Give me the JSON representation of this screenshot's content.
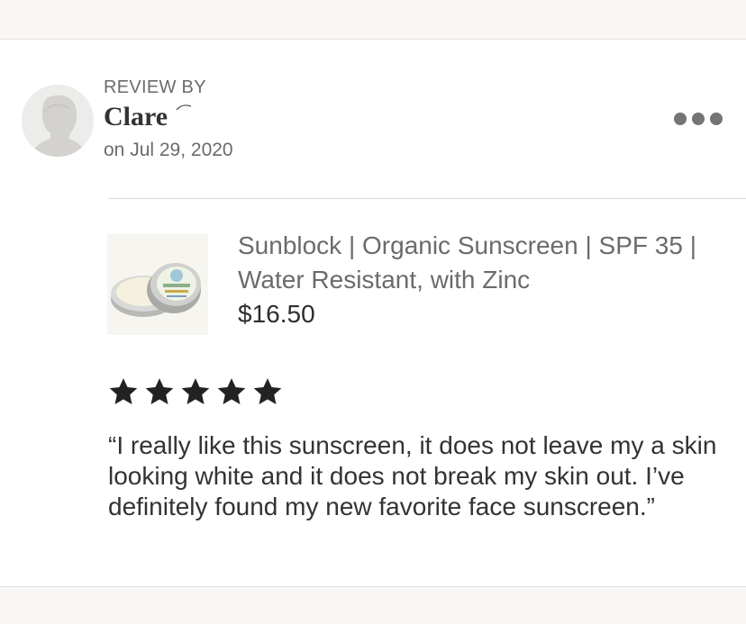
{
  "review": {
    "header_label": "REVIEW BY",
    "reviewer_name": "Clare",
    "date": "on Jul 29, 2020",
    "rating": 5,
    "rating_max": 5,
    "text": "“I really like this sunscreen, it does not leave my a skin looking white and it does not break my skin out.  I’ve definitely found my new favorite face sunscreen.”"
  },
  "product": {
    "title": "Sunblock | Organic Sunscreen | SPF 35 | Water Resistant, with Zinc",
    "price": "$16.50",
    "image_icon": "sunscreen-tin-image"
  },
  "icons": {
    "avatar": "default-avatar-icon",
    "more": "more-options-icon",
    "star": "star-icon"
  },
  "colors": {
    "background": "#ffffff",
    "band": "#f8f7f5",
    "muted_text": "#6b6b6b",
    "body_text": "#333333",
    "star": "#222222",
    "dots": "#757575"
  }
}
